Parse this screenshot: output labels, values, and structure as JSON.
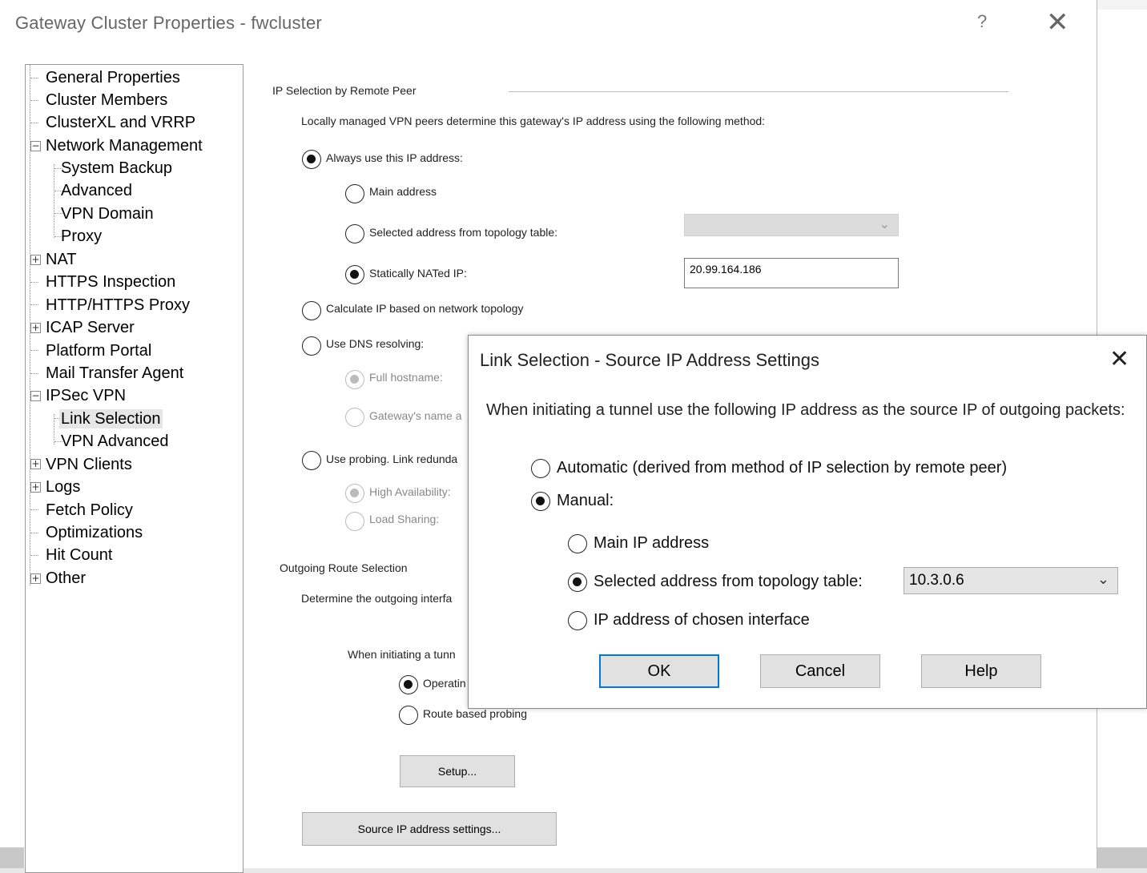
{
  "window": {
    "title": "Gateway Cluster Properties - fwcluster",
    "help_label": "?",
    "close_label": "✕"
  },
  "tree": {
    "items": [
      {
        "label": "General Properties"
      },
      {
        "label": "Cluster Members"
      },
      {
        "label": "ClusterXL and VRRP"
      },
      {
        "label": "Network Management"
      },
      {
        "label": "System Backup"
      },
      {
        "label": "Advanced"
      },
      {
        "label": "VPN Domain"
      },
      {
        "label": "Proxy"
      },
      {
        "label": "NAT"
      },
      {
        "label": "HTTPS Inspection"
      },
      {
        "label": "HTTP/HTTPS Proxy"
      },
      {
        "label": "ICAP Server"
      },
      {
        "label": "Platform Portal"
      },
      {
        "label": "Mail Transfer Agent"
      },
      {
        "label": "IPSec VPN"
      },
      {
        "label": "Link Selection"
      },
      {
        "label": "VPN Advanced"
      },
      {
        "label": "VPN Clients"
      },
      {
        "label": "Logs"
      },
      {
        "label": "Fetch Policy"
      },
      {
        "label": "Optimizations"
      },
      {
        "label": "Hit Count"
      },
      {
        "label": "Other"
      }
    ],
    "selected": "Link Selection"
  },
  "ip_selection": {
    "section_title": "IP Selection by Remote Peer",
    "description": "Locally managed VPN peers determine this gateway's IP address using the following method:",
    "always_use": "Always use this IP address:",
    "main_address": "Main address",
    "selected_from_topology": "Selected address from topology table:",
    "statically_nated": "Statically NATed IP:",
    "nated_ip_value": "20.99.164.186",
    "calculate": "Calculate IP based on network topology",
    "use_dns": "Use DNS resolving:",
    "full_hostname": "Full hostname:",
    "gateway_name": "Gateway's name a",
    "use_probing": "Use probing. Link redunda",
    "high_availability": "High Availability:",
    "load_sharing": "Load Sharing:"
  },
  "outgoing": {
    "section_title": "Outgoing Route Selection",
    "description": "Determine the outgoing interfa",
    "when_initiating": "When initiating a tunn",
    "operating": "Operatin",
    "route_based": "Route based probing",
    "setup_label": "Setup...",
    "source_ip_label": "Source IP address settings..."
  },
  "dialog": {
    "title": "Link Selection - Source IP Address Settings",
    "close_label": "✕",
    "description": "When initiating a tunnel use the following IP address as the source IP of outgoing packets:",
    "automatic": "Automatic (derived from method of IP selection by remote peer)",
    "manual": "Manual:",
    "main_ip": "Main IP address",
    "selected_from_topology": "Selected address from topology table:",
    "topology_value": "10.3.0.6",
    "ip_of_interface": "IP address of chosen interface",
    "ok_label": "OK",
    "cancel_label": "Cancel",
    "help_label": "Help"
  }
}
